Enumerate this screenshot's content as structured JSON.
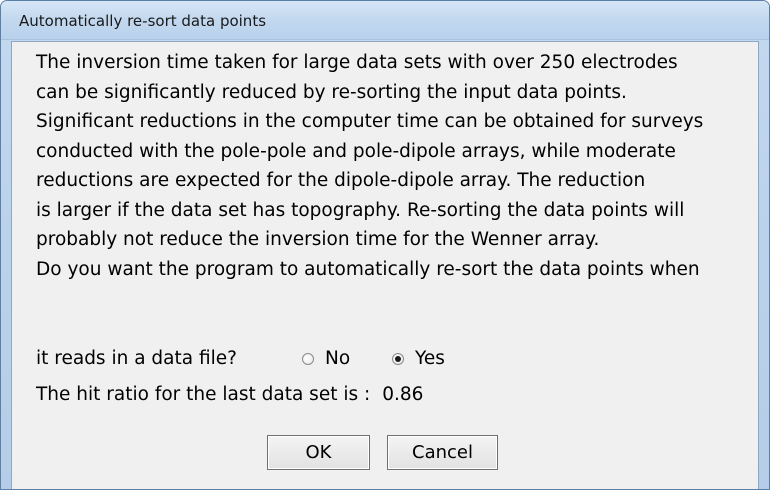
{
  "dialog": {
    "title": "Automatically re-sort data points",
    "message_lines": [
      "The inversion time taken for large data sets with over 250 electrodes",
      "can be significantly reduced by re-sorting the input data points.",
      "Significant reductions in the computer time can be obtained for surveys",
      "conducted with the pole-pole and pole-dipole arrays, while moderate",
      "reductions are expected for the dipole-dipole array. The reduction",
      "is larger if the data set has topography. Re-sorting the data points will",
      "probably not reduce the inversion time for the Wenner array.",
      "Do you want the program to automatically re-sort the data points when"
    ],
    "question_tail": "it reads in a data file?",
    "options": [
      {
        "label": "No",
        "checked": false
      },
      {
        "label": "Yes",
        "checked": true
      }
    ],
    "hit_ratio_label": "The hit ratio for the last data set is :",
    "hit_ratio_value": "0.86",
    "buttons": {
      "ok": "OK",
      "cancel": "Cancel"
    }
  }
}
